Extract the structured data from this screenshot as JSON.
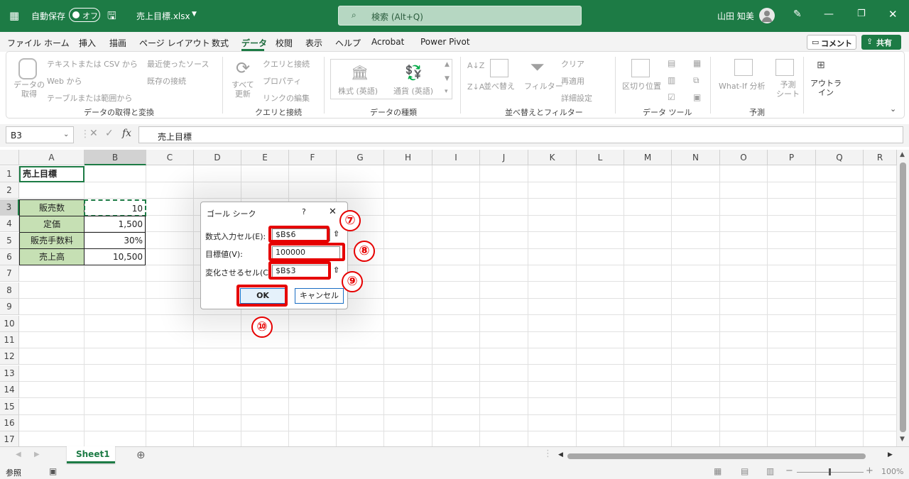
{
  "title_bar": {
    "autosave_label": "自動保存",
    "autosave_state": "オフ",
    "filename": "売上目標.xlsx",
    "search_placeholder": "検索 (Alt+Q)",
    "user_name": "山田 知美"
  },
  "menu_tabs": [
    "ファイル",
    "ホーム",
    "挿入",
    "描画",
    "ページ レイアウト",
    "数式",
    "データ",
    "校閲",
    "表示",
    "ヘルプ",
    "Acrobat",
    "Power Pivot"
  ],
  "active_tab": "データ",
  "comment_button": "コメント",
  "share_button": "共有",
  "ribbon": {
    "get_data": "データの\n取得",
    "text_csv": "テキストまたは CSV から",
    "from_web": "Web から",
    "from_table": "テーブルまたは範囲から",
    "recent_sources": "最近使ったソース",
    "existing_connections": "既存の接続",
    "refresh_all": "すべて\n更新",
    "queries_connections": "クエリと接続",
    "properties": "プロパティ",
    "edit_links": "リンクの編集",
    "stocks": "株式 (英語)",
    "currencies": "通貨 (英語)",
    "sort": "並べ替え",
    "filter": "フィルター",
    "clear": "クリア",
    "reapply": "再適用",
    "advanced": "詳細設定",
    "text_to_columns": "区切り位置",
    "what_if": "What-If 分析",
    "forecast_sheet": "予測\nシート",
    "outline": "アウトラ\nイン",
    "groups": [
      "データの取得と変換",
      "クエリと接続",
      "データの種類",
      "並べ替えとフィルター",
      "データ ツール",
      "予測"
    ]
  },
  "formula_bar": {
    "name_box": "B3",
    "fx": "fx",
    "content": "売上目標"
  },
  "columns": [
    "A",
    "B",
    "C",
    "D",
    "E",
    "F",
    "G",
    "H",
    "I",
    "J",
    "K",
    "L",
    "M",
    "N",
    "O",
    "P",
    "Q",
    "R"
  ],
  "rows": [
    "1",
    "2",
    "3",
    "4",
    "5",
    "6",
    "7",
    "8",
    "9",
    "10",
    "11",
    "12",
    "13",
    "14",
    "15",
    "16",
    "17"
  ],
  "cells": {
    "A1": "売上目標",
    "A3": "販売数",
    "B3": "10",
    "A4": "定価",
    "B4": "1,500",
    "A5": "販売手数料",
    "B5": "30%",
    "A6": "売上高",
    "B6": "10,500"
  },
  "dialog": {
    "title": "ゴール シーク",
    "help": "?",
    "close": "✕",
    "set_cell_label": "数式入力セル(E):",
    "set_cell_value": "$B$6",
    "to_value_label": "目標値(V):",
    "to_value_value": "100000",
    "changing_cell_label": "変化させるセル(C):",
    "changing_cell_value": "$B$3",
    "ok": "OK",
    "cancel": "キャンセル"
  },
  "annotations": [
    "⑦",
    "⑧",
    "⑨",
    "⑩"
  ],
  "annotation_color": "#e60000",
  "accent_color": "#1d7b45",
  "sheet_tab": "Sheet1",
  "status": {
    "mode": "参照",
    "zoom": "100%"
  }
}
